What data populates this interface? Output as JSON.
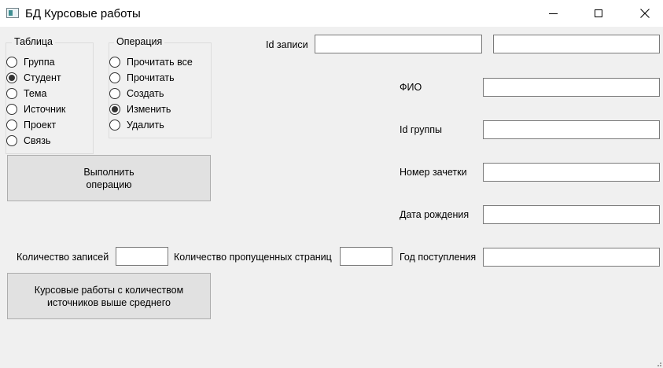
{
  "window": {
    "title": "БД Курсовые работы"
  },
  "table_group": {
    "title": "Таблица",
    "options": [
      {
        "label": "Группа",
        "checked": false
      },
      {
        "label": "Студент",
        "checked": true
      },
      {
        "label": "Тема",
        "checked": false
      },
      {
        "label": "Источник",
        "checked": false
      },
      {
        "label": "Проект",
        "checked": false
      },
      {
        "label": "Связь",
        "checked": false
      }
    ]
  },
  "operation_group": {
    "title": "Операция",
    "options": [
      {
        "label": "Прочитать все",
        "checked": false
      },
      {
        "label": "Прочитать",
        "checked": false
      },
      {
        "label": "Создать",
        "checked": false
      },
      {
        "label": "Изменить",
        "checked": true
      },
      {
        "label": "Удалить",
        "checked": false
      }
    ]
  },
  "execute_button": {
    "label": "Выполнить\nоперацию"
  },
  "query_button": {
    "label": "Курсовые работы с количеством\nисточников выше среднего"
  },
  "paging": {
    "records_label": "Количество записей",
    "records_value": "",
    "skipped_label": "Количество пропущенных страниц",
    "skipped_value": ""
  },
  "record": {
    "id_label": "Id записи",
    "id_value": "",
    "id_value2": "",
    "fields": [
      {
        "label": "ФИО",
        "value": ""
      },
      {
        "label": "Id группы",
        "value": ""
      },
      {
        "label": "Номер зачетки",
        "value": ""
      },
      {
        "label": "Дата рождения",
        "value": ""
      },
      {
        "label": "Год поступления",
        "value": ""
      }
    ]
  }
}
